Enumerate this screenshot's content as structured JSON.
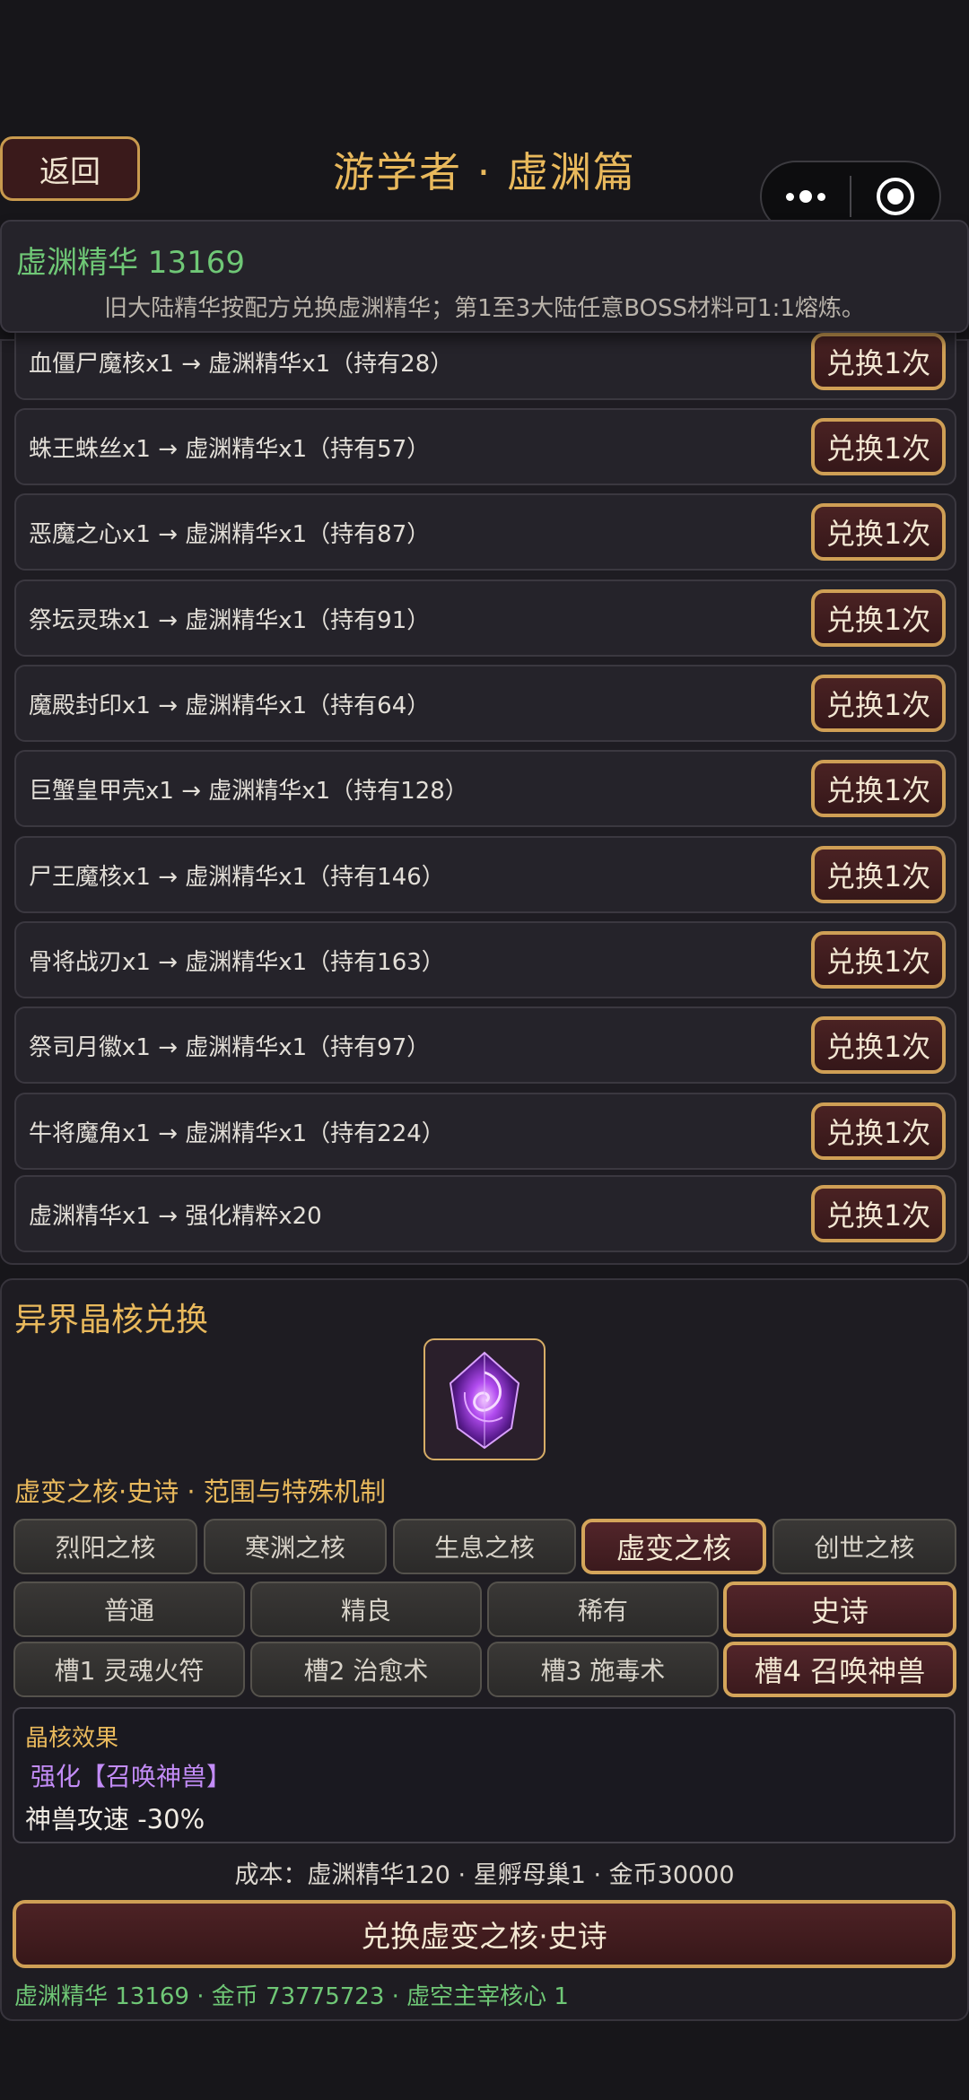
{
  "nav": {
    "back_label": "返回",
    "title": "游学者 · 虚渊篇"
  },
  "essence": {
    "title": "虚渊精华 13169",
    "description": "旧大陆精华按配方兑换虚渊精华；第1至3大陆任意BOSS材料可1:1熔炼。"
  },
  "exchange_list": {
    "button_label": "兑换1次",
    "rows": [
      {
        "text": "血僵尸魔核x1 → 虚渊精华x1（持有28）"
      },
      {
        "text": "蛛王蛛丝x1 → 虚渊精华x1（持有57）"
      },
      {
        "text": "恶魔之心x1 → 虚渊精华x1（持有87）"
      },
      {
        "text": "祭坛灵珠x1 → 虚渊精华x1（持有91）"
      },
      {
        "text": "魔殿封印x1 → 虚渊精华x1（持有64）"
      },
      {
        "text": "巨蟹皇甲壳x1 → 虚渊精华x1（持有128）"
      },
      {
        "text": "尸王魔核x1 → 虚渊精华x1（持有146）"
      },
      {
        "text": "骨将战刃x1 → 虚渊精华x1（持有163）"
      },
      {
        "text": "祭司月徽x1 → 虚渊精华x1（持有97）"
      },
      {
        "text": "牛将魔角x1 → 虚渊精华x1（持有224）"
      },
      {
        "text": "虚渊精华x1 → 强化精粹x20"
      }
    ]
  },
  "core": {
    "title": "异界晶核兑换",
    "subtitle": "虚变之核·史诗 · 范围与特殊机制",
    "core_types": [
      "烈阳之核",
      "寒渊之核",
      "生息之核",
      "虚变之核",
      "创世之核"
    ],
    "selected_core": "虚变之核",
    "rarities": [
      "普通",
      "精良",
      "稀有",
      "史诗"
    ],
    "selected_rarity": "史诗",
    "slots": [
      "槽1 灵魂火符",
      "槽2 治愈术",
      "槽3 施毒术",
      "槽4 召唤神兽"
    ],
    "selected_slot": "槽4 召唤神兽",
    "effect_label": "晶核效果",
    "effect_enhance": "强化【召唤神兽】",
    "effect_value": "神兽攻速 -30%",
    "cost": "成本：虚渊精华120 · 星孵母巢1 · 金币30000",
    "exchange_button": "兑换虚变之核·史诗",
    "balance": "虚渊精华 13169 · 金币 73775723 · 虚空主宰核心 1"
  },
  "colors": {
    "accent_gold": "#e9b95c",
    "essence_green": "#6fc776",
    "enhance_purple": "#c38cf7",
    "button_border": "#cf9f55"
  }
}
